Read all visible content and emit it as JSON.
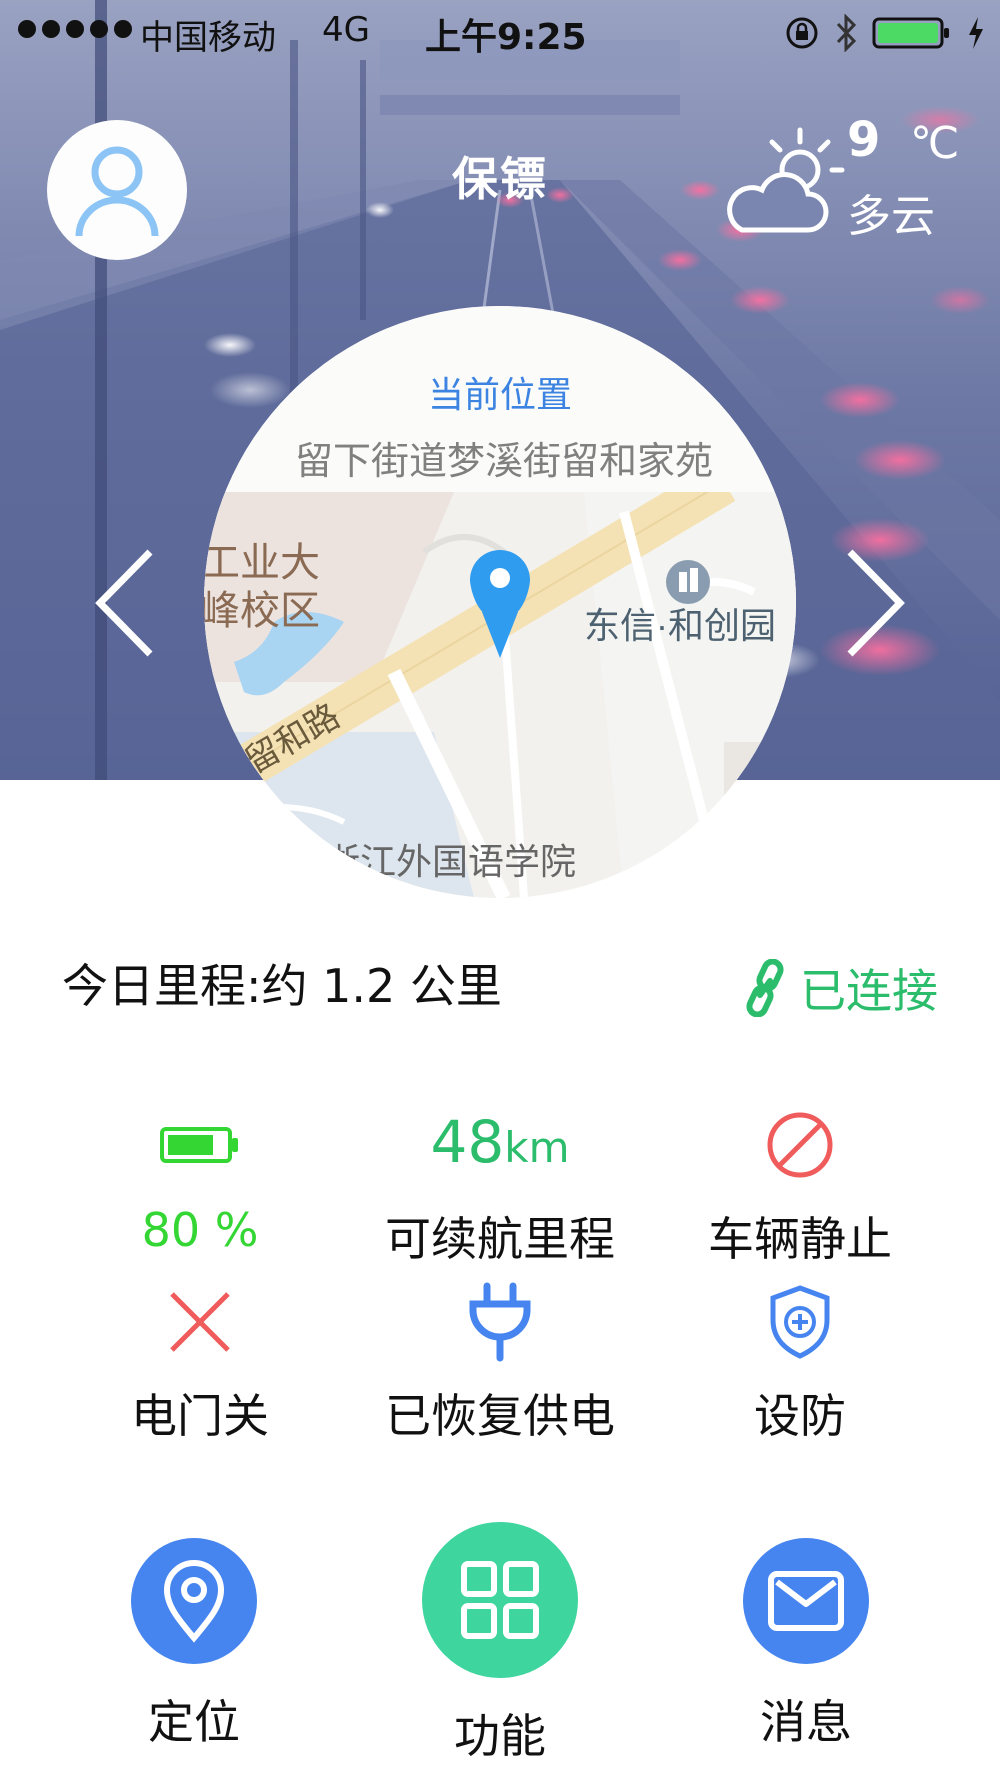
{
  "status_bar": {
    "carrier": "中国移动",
    "network": "4G",
    "time": "上午9:25",
    "battery_color": "#4cd964"
  },
  "header": {
    "title": "保镖",
    "avatar_icon": "user-icon",
    "weather": {
      "temperature": "9",
      "unit": "℃",
      "condition": "多云",
      "icon": "partly-cloudy-icon"
    }
  },
  "map": {
    "label": "当前位置",
    "address": "留下街道梦溪街留和家苑",
    "places": {
      "campus": "工业大\n峰校区",
      "campus_line1": "工业大",
      "campus_line2": "峰校区",
      "building": "东信·和创园",
      "road": "留和路",
      "school": "浙江外国语学院"
    },
    "pin_color": "#2f9cf0"
  },
  "summary": {
    "mileage_text": "今日里程:约 1.2 公里",
    "connection_text": "已连接",
    "connection_color": "#2bbd6b"
  },
  "status": {
    "battery": {
      "percent": "80 %",
      "level": 0.8,
      "icon": "battery-icon"
    },
    "range": {
      "value": "48",
      "unit": "km",
      "label": "可续航里程"
    },
    "motion": {
      "label": "车辆静止",
      "icon": "prohibited-icon",
      "color": "#f05b5b"
    },
    "door": {
      "label": "电门关",
      "icon": "close-icon",
      "color": "#f05b5b"
    },
    "power": {
      "label": "已恢复供电",
      "icon": "plug-icon",
      "color": "#4685f0"
    },
    "defense": {
      "label": "设防",
      "icon": "shield-plus-icon",
      "color": "#4685f0"
    }
  },
  "nav": {
    "locate": {
      "label": "定位",
      "icon": "location-pin-icon"
    },
    "functions": {
      "label": "功能",
      "icon": "grid-icon"
    },
    "messages": {
      "label": "消息",
      "icon": "mail-icon"
    }
  }
}
